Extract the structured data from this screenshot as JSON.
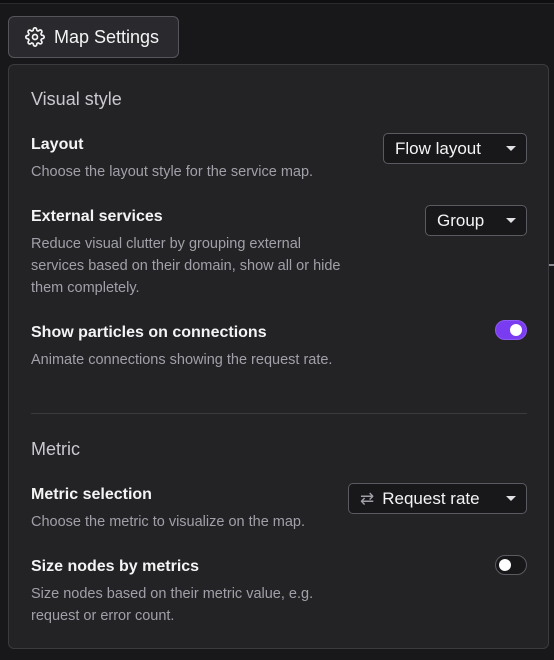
{
  "header": {
    "button_label": "Map Settings",
    "icon": "gear-icon"
  },
  "visual_style": {
    "title": "Visual style",
    "layout": {
      "label": "Layout",
      "description": "Choose the layout style for the service map.",
      "selected": "Flow layout"
    },
    "external_services": {
      "label": "External services",
      "description": "Reduce visual clutter by grouping external services based on their domain, show all or hide them completely.",
      "selected": "Group"
    },
    "particles": {
      "label": "Show particles on connections",
      "description": "Animate connections showing the request rate.",
      "enabled": true
    }
  },
  "metric": {
    "title": "Metric",
    "selection": {
      "label": "Metric selection",
      "description": "Choose the metric to visualize on the map.",
      "selected": "Request rate",
      "icon": "swap-arrows-icon"
    },
    "size_nodes": {
      "label": "Size nodes by metrics",
      "description": "Size nodes based on their metric value, e.g. request or error count.",
      "enabled": false
    }
  },
  "colors": {
    "accent": "#7a3cf0",
    "background": "#18181b",
    "panel": "#232326"
  }
}
